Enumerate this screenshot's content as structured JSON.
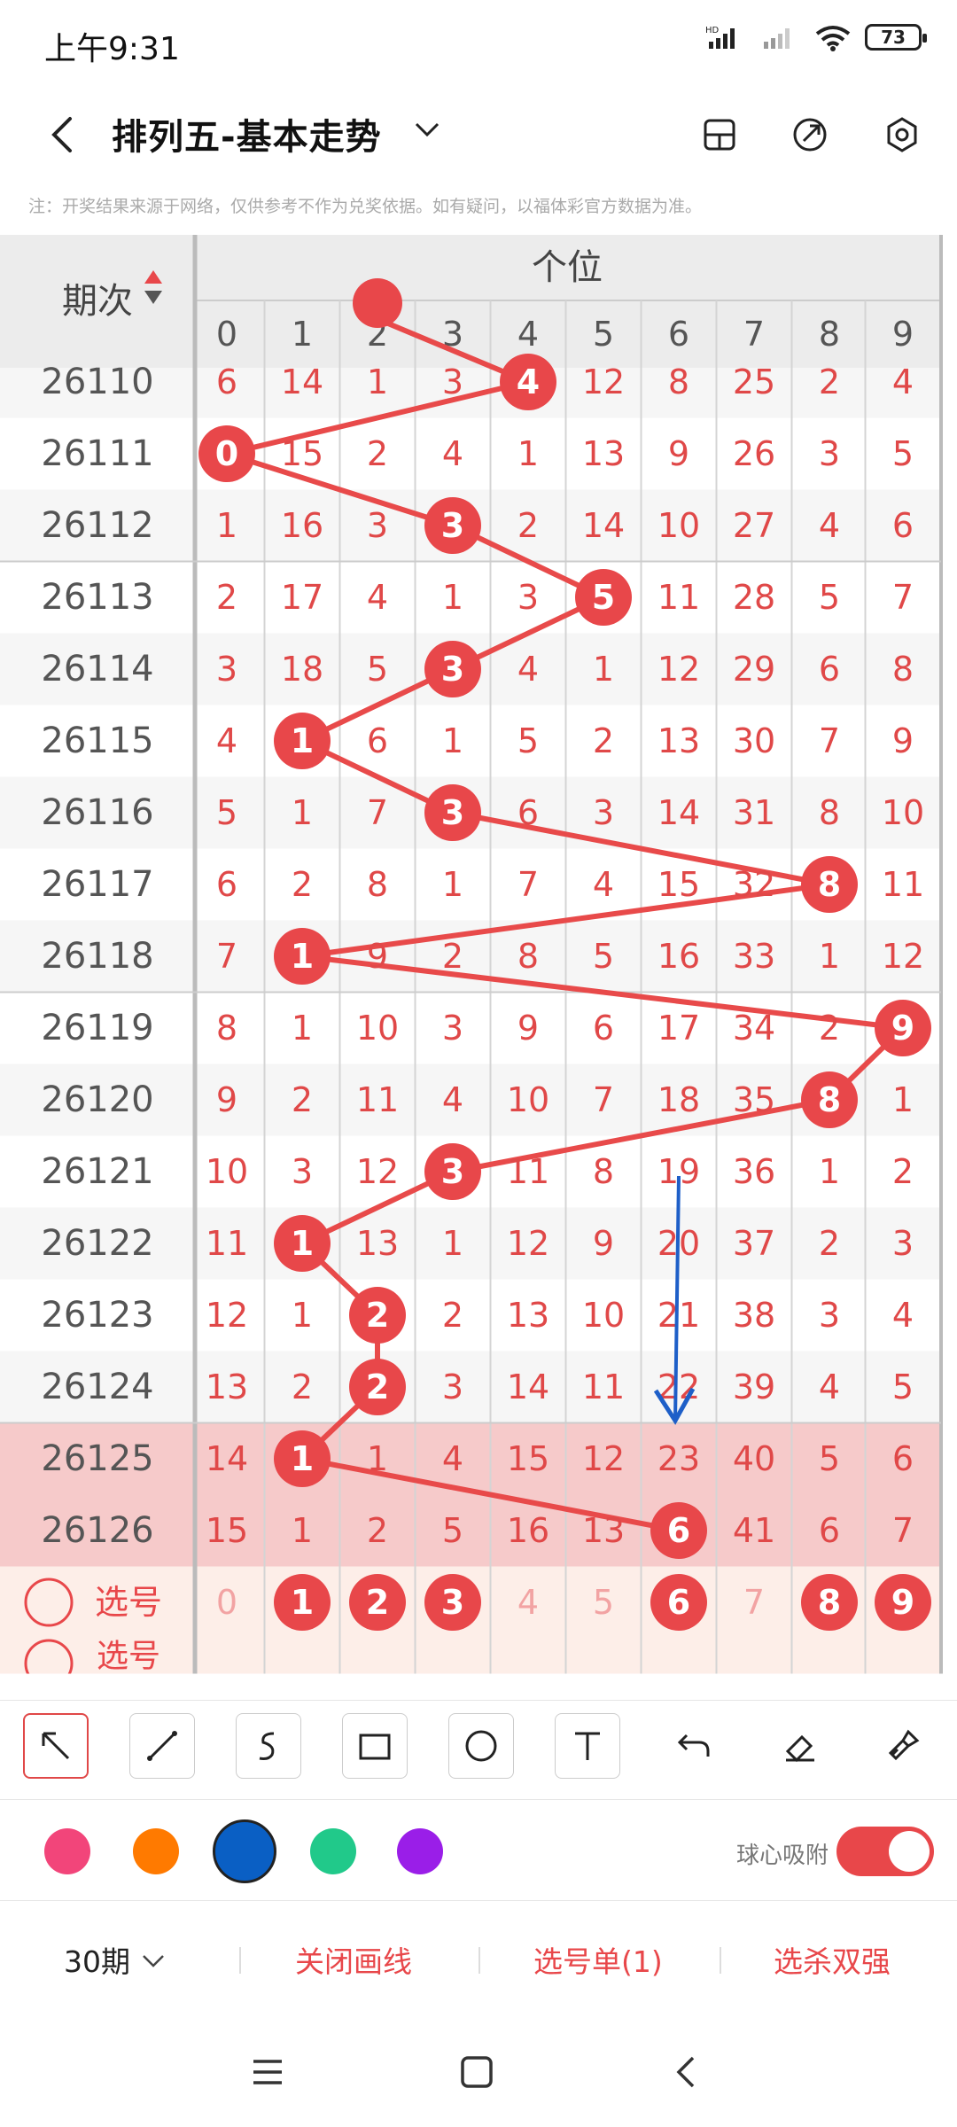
{
  "status_bar": {
    "time": "上午9:31",
    "network": "HD",
    "battery": "73"
  },
  "header": {
    "title": "排列五-基本走势"
  },
  "notice": "注：开奖结果来源于网络，仅供参考不作为兑奖依据。如有疑问，以福体彩官方数据为准。",
  "table": {
    "period_header": "期次",
    "group_header": "个位",
    "digits": [
      "0",
      "1",
      "2",
      "3",
      "4",
      "5",
      "6",
      "7",
      "8",
      "9"
    ],
    "rows": [
      {
        "period": "26110",
        "cells": [
          "6",
          "14",
          "1",
          "3",
          "4",
          "12",
          "8",
          "25",
          "2",
          "4"
        ],
        "hit": 4
      },
      {
        "period": "26111",
        "cells": [
          "0",
          "15",
          "2",
          "4",
          "1",
          "13",
          "9",
          "26",
          "3",
          "5"
        ],
        "hit": 0
      },
      {
        "period": "26112",
        "cells": [
          "1",
          "16",
          "3",
          "3",
          "2",
          "14",
          "10",
          "27",
          "4",
          "6"
        ],
        "hit": 3
      },
      {
        "period": "26113",
        "cells": [
          "2",
          "17",
          "4",
          "1",
          "3",
          "5",
          "11",
          "28",
          "5",
          "7"
        ],
        "hit": 5
      },
      {
        "period": "26114",
        "cells": [
          "3",
          "18",
          "5",
          "3",
          "4",
          "1",
          "12",
          "29",
          "6",
          "8"
        ],
        "hit": 3
      },
      {
        "period": "26115",
        "cells": [
          "4",
          "1",
          "6",
          "1",
          "5",
          "2",
          "13",
          "30",
          "7",
          "9"
        ],
        "hit": 1
      },
      {
        "period": "26116",
        "cells": [
          "5",
          "1",
          "7",
          "3",
          "6",
          "3",
          "14",
          "31",
          "8",
          "10"
        ],
        "hit": 3
      },
      {
        "period": "26117",
        "cells": [
          "6",
          "2",
          "8",
          "1",
          "7",
          "4",
          "15",
          "32",
          "8",
          "11"
        ],
        "hit": 8
      },
      {
        "period": "26118",
        "cells": [
          "7",
          "1",
          "9",
          "2",
          "8",
          "5",
          "16",
          "33",
          "1",
          "12"
        ],
        "hit": 1
      },
      {
        "period": "26119",
        "cells": [
          "8",
          "1",
          "10",
          "3",
          "9",
          "6",
          "17",
          "34",
          "2",
          "9"
        ],
        "hit": 9
      },
      {
        "period": "26120",
        "cells": [
          "9",
          "2",
          "11",
          "4",
          "10",
          "7",
          "18",
          "35",
          "8",
          "1"
        ],
        "hit": 8
      },
      {
        "period": "26121",
        "cells": [
          "10",
          "3",
          "12",
          "3",
          "11",
          "8",
          "19",
          "36",
          "1",
          "2"
        ],
        "hit": 3
      },
      {
        "period": "26122",
        "cells": [
          "11",
          "1",
          "13",
          "1",
          "12",
          "9",
          "20",
          "37",
          "2",
          "3"
        ],
        "hit": 1
      },
      {
        "period": "26123",
        "cells": [
          "12",
          "1",
          "2",
          "2",
          "13",
          "10",
          "21",
          "38",
          "3",
          "4"
        ],
        "hit": 2
      },
      {
        "period": "26124",
        "cells": [
          "13",
          "2",
          "2",
          "3",
          "14",
          "11",
          "22",
          "39",
          "4",
          "5"
        ],
        "hit": 2
      },
      {
        "period": "26125",
        "cells": [
          "14",
          "1",
          "1",
          "4",
          "15",
          "12",
          "23",
          "40",
          "5",
          "6"
        ],
        "hit": 1
      },
      {
        "period": "26126",
        "cells": [
          "15",
          "1",
          "2",
          "5",
          "16",
          "13",
          "6",
          "41",
          "6",
          "7"
        ],
        "hit": 6
      }
    ],
    "pick_row": {
      "label": "选号",
      "cells": [
        "0",
        "1",
        "2",
        "3",
        "4",
        "5",
        "6",
        "7",
        "8",
        "9"
      ],
      "selected": [
        1,
        2,
        3,
        6,
        8,
        9
      ]
    },
    "partial_row_label": "选号"
  },
  "colors": {
    "accent": "#e8474a",
    "hit_ball": "#e8474a",
    "line": "#e84a4a",
    "arrow": "#1e5fc8",
    "highlight_row": "#f6caca",
    "pick_row_bg": "#fdeee8",
    "palette": [
      "#f2457a",
      "#ff7a00",
      "#0a5fc4",
      "#21c98a",
      "#9a1ee8"
    ]
  },
  "palette_selected": "#0a5fc4",
  "snap_label": "球心吸附",
  "bottom_bar": {
    "periods": "30期",
    "close_lines": "关闭画线",
    "pick_list": "选号单(1)",
    "kill": "选杀双强"
  },
  "toolbar": [
    "pointer-tool",
    "line-tool",
    "curve-tool",
    "rectangle-tool",
    "circle-tool",
    "text-tool",
    "undo-tool",
    "eraser-tool",
    "clear-tool"
  ]
}
